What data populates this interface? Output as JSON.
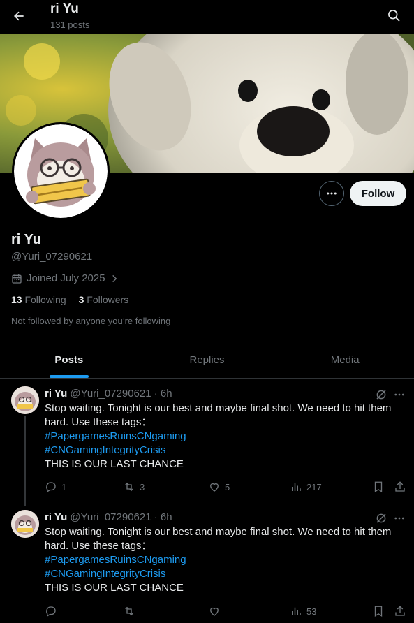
{
  "header": {
    "title": "ri Yu",
    "post_count": "131 posts"
  },
  "profile": {
    "display_name": "ri Yu",
    "handle": "@Yuri_07290621",
    "joined": "Joined July 2025",
    "following_count": "13",
    "following_label": "Following",
    "followers_count": "3",
    "followers_label": "Followers",
    "not_followed_text": "Not followed by anyone you’re following",
    "follow_label": "Follow",
    "avatar_sticker_text": "GOLDEN Ticket"
  },
  "tabs": [
    {
      "label": "Posts",
      "active": true
    },
    {
      "label": "Replies",
      "active": false
    },
    {
      "label": "Media",
      "active": false
    }
  ],
  "posts": [
    {
      "name": "ri Yu",
      "handle": "@Yuri_07290621",
      "time": "· 6h",
      "text_line1": "Stop waiting. Tonight is our best and maybe final shot. We need to hit them hard. Use these tags：",
      "tag1": "#PapergamesRuinsCNgaming",
      "tag2": "#CNGamingIntegrityCrisis",
      "text_line2": "THIS IS OUR LAST CHANCE",
      "replies": "1",
      "reposts": "3",
      "likes": "5",
      "views": "217"
    },
    {
      "name": "ri Yu",
      "handle": "@Yuri_07290621",
      "time": "· 6h",
      "text_line1": "Stop waiting. Tonight is our best and maybe final shot. We need to hit them hard. Use these tags：",
      "tag1": "#PapergamesRuinsCNgaming",
      "tag2": "#CNGamingIntegrityCrisis",
      "text_line2": "THIS IS OUR LAST CHANCE",
      "replies": "",
      "reposts": "",
      "likes": "",
      "views": "53"
    }
  ],
  "colors": {
    "background": "#000000",
    "accent": "#1d9bf0",
    "text": "#e7e9ea",
    "muted": "#71767b",
    "follow_button": "#eff3f4"
  },
  "icons": {
    "back": "arrow-left-icon",
    "search": "search-icon",
    "more": "more-dots-icon",
    "calendar": "calendar-icon",
    "reply": "reply-icon",
    "repost": "repost-icon",
    "like": "heart-icon",
    "views": "analytics-icon",
    "bookmark": "bookmark-icon",
    "share": "share-icon",
    "grok": "grok-icon"
  }
}
